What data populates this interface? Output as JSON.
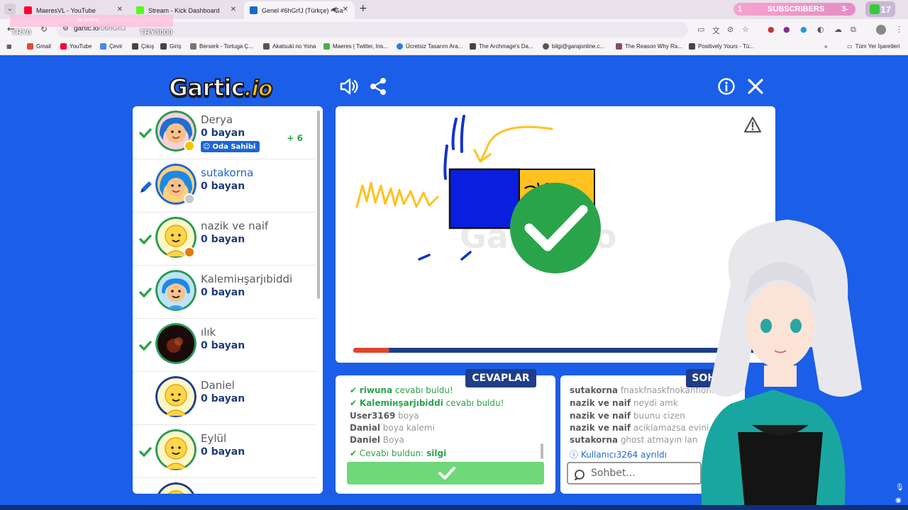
{
  "browser": {
    "tabs": [
      {
        "title": "MaeresVL - YouTube",
        "favicon_color": "#ff0033",
        "active": false
      },
      {
        "title": "Stream - Kick Dashboard",
        "favicon_color": "#53fc18",
        "active": false
      },
      {
        "title": "Genel #6hGrfJ (Türkçe) - Ga",
        "favicon_color": "#1e66d6",
        "active": true
      }
    ],
    "new_tab_icon": "plus-icon",
    "url_host": "gartic.io",
    "url_path": "/06hGrfJ",
    "subscriber_banner": {
      "left": "1",
      "label": "SUBSCRIBERS",
      "right": "3-"
    },
    "subscriber_count": "17",
    "overlay": {
      "tiny_text": "86 (0.00%)",
      "left": "TRY0",
      "right": "TRY3000"
    },
    "bookmarks": [
      {
        "label": "Gmail",
        "color": "#e04b3a"
      },
      {
        "label": "YouTube",
        "color": "#ff0033"
      },
      {
        "label": "Çevir",
        "color": "#4a86e8"
      },
      {
        "label": "Çıkış",
        "color": "#444444"
      },
      {
        "label": "Giriş",
        "color": "#444444"
      },
      {
        "label": "Berserk - Tortuga Ç...",
        "color": "#777777"
      },
      {
        "label": "Akatsuki no Yona",
        "color": "#555555"
      },
      {
        "label": "Maeres | Twitter, Ins...",
        "color": "#4caf50"
      },
      {
        "label": "Ücretsiz Tasarım Ara...",
        "color": "#2d7be5"
      },
      {
        "label": "The Archmage's Da...",
        "color": "#444444"
      },
      {
        "label": "bilgi@garajonline.c...",
        "color": "#555555"
      },
      {
        "label": "The Reason Why Ra...",
        "color": "#8a4b6b"
      },
      {
        "label": "Positively Yours - Tü...",
        "color": "#444444"
      }
    ],
    "all_bookmarks": "Tüm Yer İşaretleri"
  },
  "game": {
    "logo_main": "Gartic",
    "logo_suffix": ".io",
    "players": [
      {
        "name": "Derya",
        "points": "0 bayan",
        "status": "guessed",
        "dot": "#f5c400",
        "avatar": "girl-pink",
        "owner_label": "Oda Sahibi",
        "plus": "+ 6"
      },
      {
        "name": "sutakorna",
        "points": "0 bayan",
        "status": "drawing",
        "dot": "#c9c9c9",
        "avatar": "girl-blue"
      },
      {
        "name": "nazik ve naif",
        "points": "0 bayan",
        "status": "guessed",
        "dot": "#e07a10",
        "avatar": "default"
      },
      {
        "name": "Kalemінşarjıbiddi",
        "points": "0 bayan",
        "status": "guessed",
        "avatar": "boy-blue"
      },
      {
        "name": "ılık",
        "points": "0 bayan",
        "status": "guessed",
        "avatar": "photo"
      },
      {
        "name": "Daniel",
        "points": "0 bayan",
        "status": "none",
        "avatar": "default"
      },
      {
        "name": "Eylül",
        "points": "0 bayan",
        "status": "guessed",
        "avatar": "default"
      }
    ],
    "timer_fraction": 0.09,
    "answers_title": "CEVAPLAR",
    "chat_title": "SOHBET",
    "answers": [
      {
        "type": "found",
        "name": "riwuna",
        "text": "cevabı buldu!"
      },
      {
        "type": "found",
        "name": "Kalemінşarjıbiddi",
        "text": "cevabı buldu!"
      },
      {
        "type": "guess",
        "name": "User3169",
        "text": "boya"
      },
      {
        "type": "guess",
        "name": "Danial",
        "text": "boya kalemi"
      },
      {
        "type": "guess",
        "name": "Daniel",
        "text": "Boya"
      },
      {
        "type": "self",
        "prefix": "Cevabı buldun:",
        "word": "silgi"
      }
    ],
    "chat": [
      {
        "name": "sutakorna",
        "text": "fnaskfnaskfnokanfıonıoaf"
      },
      {
        "name": "nazik ve naif",
        "text": "neydi amk"
      },
      {
        "name": "nazik ve naif",
        "text": "buunu cizen"
      },
      {
        "name": "nazik ve naif",
        "text": "aciklamazsa evini bu"
      },
      {
        "name": "sutakorna",
        "text": "ghost atmayın lan"
      },
      {
        "type": "info",
        "name": "Kullanıcı3264",
        "text": "ayrıldı"
      }
    ],
    "chat_placeholder": "Sohbet...",
    "colors": {
      "page_bg": "#1b5ee8",
      "navy": "#1e3e8a",
      "green": "#2aa44a",
      "timer": "#e2452f"
    }
  }
}
